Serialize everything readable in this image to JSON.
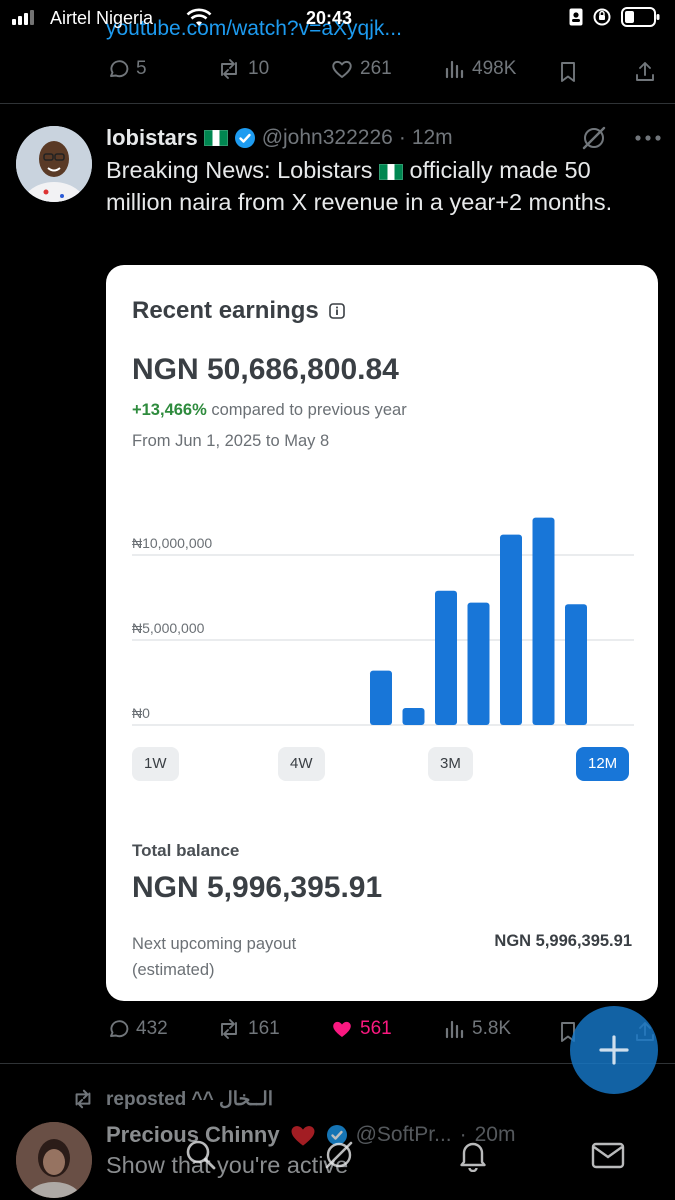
{
  "status_bar": {
    "carrier": "Airtel Nigeria",
    "time": "20:43"
  },
  "prev_tweet": {
    "link_text": "youtube.com/watch?v=aXyqjk...",
    "actions": {
      "replies": "5",
      "reposts": "10",
      "likes": "261",
      "views": "498K"
    }
  },
  "tweet": {
    "name": "lobistars",
    "handle": "@john322226",
    "time": "12m",
    "text_before": "Breaking News: Lobistars",
    "text_after": " officially made 50 million naira from X revenue in a year+2 months.",
    "actions": {
      "replies": "432",
      "reposts": "161",
      "likes": "561",
      "views": "5.8K"
    }
  },
  "card": {
    "title": "Recent earnings",
    "amount": "NGN 50,686,800.84",
    "change": "+13,466%",
    "change_text": " compared to previous year",
    "range_text": "From Jun 1, 2025 to May 8",
    "range_buttons": [
      "1W",
      "4W",
      "3M",
      "12M"
    ],
    "active_range": "12M",
    "balance_label": "Total balance",
    "balance": "NGN 5,996,395.91",
    "payout_label": "Next upcoming payout (estimated)",
    "payout_value": "NGN 5,996,395.91"
  },
  "chart_data": {
    "type": "bar",
    "y_tick_labels": [
      "₦0",
      "₦5,000,000",
      "₦10,000,000"
    ],
    "y_ticks": [
      0,
      5000000,
      10000000
    ],
    "ylim": [
      0,
      10000000
    ],
    "values": [
      0,
      0,
      0,
      0,
      0,
      0,
      0,
      3200000,
      1000000,
      7900000,
      7200000,
      11200000,
      12200000,
      7100000
    ],
    "bar_color": "#1876d8"
  },
  "next_tweet": {
    "repost_label": "reposted ^^ الــخال",
    "name": "Precious Chinny",
    "handle": "@SoftPr...",
    "time": "20m",
    "text": "Show that you're active"
  },
  "colors": {
    "accent": "#1d9bf0",
    "like": "#f91880",
    "muted": "#71767b"
  }
}
